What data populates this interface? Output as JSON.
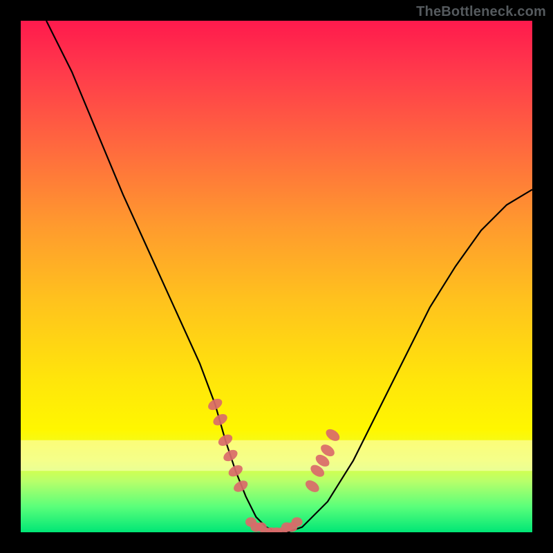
{
  "watermark": "TheBottleneck.com",
  "chart_data": {
    "type": "line",
    "title": "",
    "xlabel": "",
    "ylabel": "",
    "xlim": [
      0,
      100
    ],
    "ylim": [
      0,
      100
    ],
    "grid": false,
    "legend": false,
    "series": [
      {
        "name": "curve",
        "x": [
          5,
          10,
          15,
          20,
          25,
          30,
          35,
          38,
          40,
          42,
          44,
          46,
          48,
          50,
          52,
          55,
          60,
          65,
          70,
          75,
          80,
          85,
          90,
          95,
          100
        ],
        "y": [
          100,
          90,
          78,
          66,
          55,
          44,
          33,
          25,
          18,
          12,
          7,
          3,
          1,
          0,
          0,
          1,
          6,
          14,
          24,
          34,
          44,
          52,
          59,
          64,
          67
        ]
      },
      {
        "name": "marker-cluster-left",
        "x": [
          38,
          39,
          40,
          41,
          42,
          43
        ],
        "y": [
          25,
          22,
          18,
          15,
          12,
          9
        ]
      },
      {
        "name": "marker-cluster-bottom",
        "x": [
          45,
          46,
          47,
          48,
          49,
          50,
          51,
          52,
          53,
          54
        ],
        "y": [
          2,
          1,
          1,
          0,
          0,
          0,
          0,
          1,
          1,
          2
        ]
      },
      {
        "name": "marker-cluster-right",
        "x": [
          57,
          58,
          59,
          60,
          61
        ],
        "y": [
          9,
          12,
          14,
          16,
          19
        ]
      }
    ],
    "colors": {
      "curve": "#000000",
      "markers": "#d96a6a",
      "gradient_top": "#ff1a4d",
      "gradient_bottom": "#00e676"
    },
    "pale_band": {
      "y_range": [
        12,
        18
      ],
      "note": "light horizontal band near bottom"
    }
  }
}
